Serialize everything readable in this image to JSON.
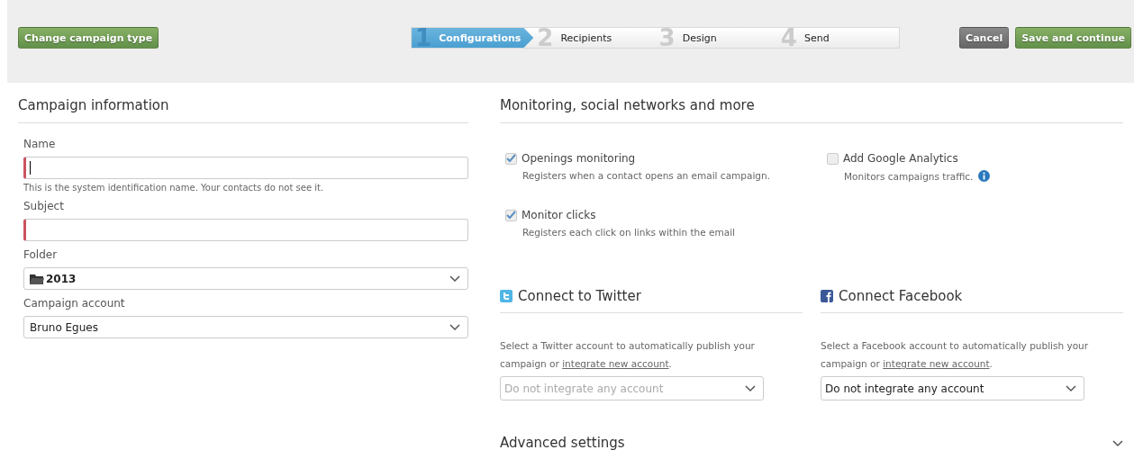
{
  "toolbar": {
    "change_button": "Change campaign type",
    "steps": [
      {
        "number": "1",
        "label": "Configurations",
        "selected": true
      },
      {
        "number": "2",
        "label": "Recipients",
        "selected": false
      },
      {
        "number": "3",
        "label": "Design",
        "selected": false
      },
      {
        "number": "4",
        "label": "Send",
        "selected": false
      }
    ],
    "cancel_button": "Cancel",
    "save_button": "Save and continue"
  },
  "campaign_info": {
    "title": "Campaign information",
    "fields": [
      {
        "kind": "text",
        "label": "Name",
        "focused": true,
        "invalid": true,
        "hint": "This is the system identification name. Your contacts do not see it."
      },
      {
        "kind": "text",
        "label": "Subject",
        "focused": false,
        "invalid": true
      },
      {
        "kind": "folder-select",
        "label": "Folder",
        "value": "2013"
      },
      {
        "kind": "select",
        "label": "Campaign account",
        "value": "Bruno Egues"
      }
    ]
  },
  "monitoring": {
    "title": "Monitoring, social networks and more",
    "options": [
      {
        "label": "Openings monitoring",
        "description": "Registers when a contact opens an email campaign.",
        "checked": true,
        "info": false
      },
      {
        "label": "Add Google Analytics",
        "description": "Monitors campaigns traffic.",
        "checked": false,
        "info": true
      },
      {
        "label": "Monitor clicks",
        "description": "Registers each click on links within the email",
        "checked": true,
        "info": false
      }
    ]
  },
  "social": [
    {
      "kind": "twitter",
      "title": "Connect to Twitter",
      "text": "Select a Twitter account to automatically publish your campaign or ",
      "link": "integrate new account",
      "text_end": ".",
      "select": "Do not integrate any account",
      "disabled": true
    },
    {
      "kind": "facebook",
      "title": "Connect Facebook",
      "text": "Select a Facebook account to automatically publish your campaign or ",
      "link": "integrate new account",
      "text_end": ".",
      "select": "Do not integrate any account",
      "disabled": false
    }
  ],
  "advanced": {
    "title": "Advanced settings",
    "expanded": false
  }
}
